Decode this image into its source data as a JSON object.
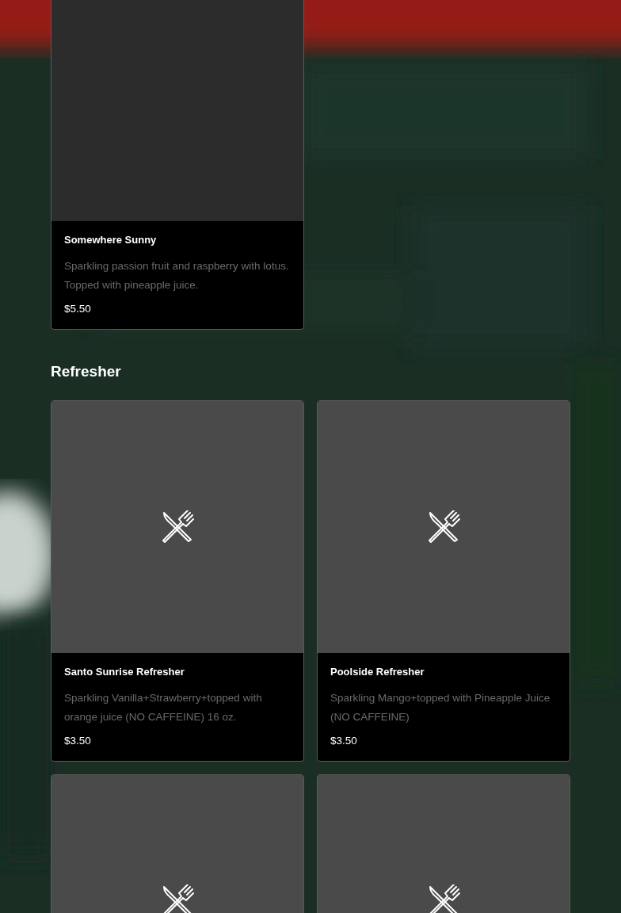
{
  "sections": [
    {
      "items": [
        {
          "kind": "blank",
          "name": "Somewhere Sunny",
          "description": "Sparkling passion fruit and raspberry with lotus. Topped with pineapple juice.",
          "price": "$5.50"
        }
      ]
    },
    {
      "title": "Refresher",
      "items": [
        {
          "kind": "placeholder",
          "name": "Santo Sunrise Refresher",
          "description": "Sparkling Vanilla+Strawberry+topped with orange juice (NO CAFFEINE) 16 oz.",
          "price": "$3.50"
        },
        {
          "kind": "placeholder",
          "name": "Poolside Refresher",
          "description": "Sparkling Mango+topped with Pineapple Juice (NO CAFFEINE)",
          "price": "$3.50"
        },
        {
          "kind": "placeholder"
        },
        {
          "kind": "placeholder"
        }
      ]
    }
  ]
}
